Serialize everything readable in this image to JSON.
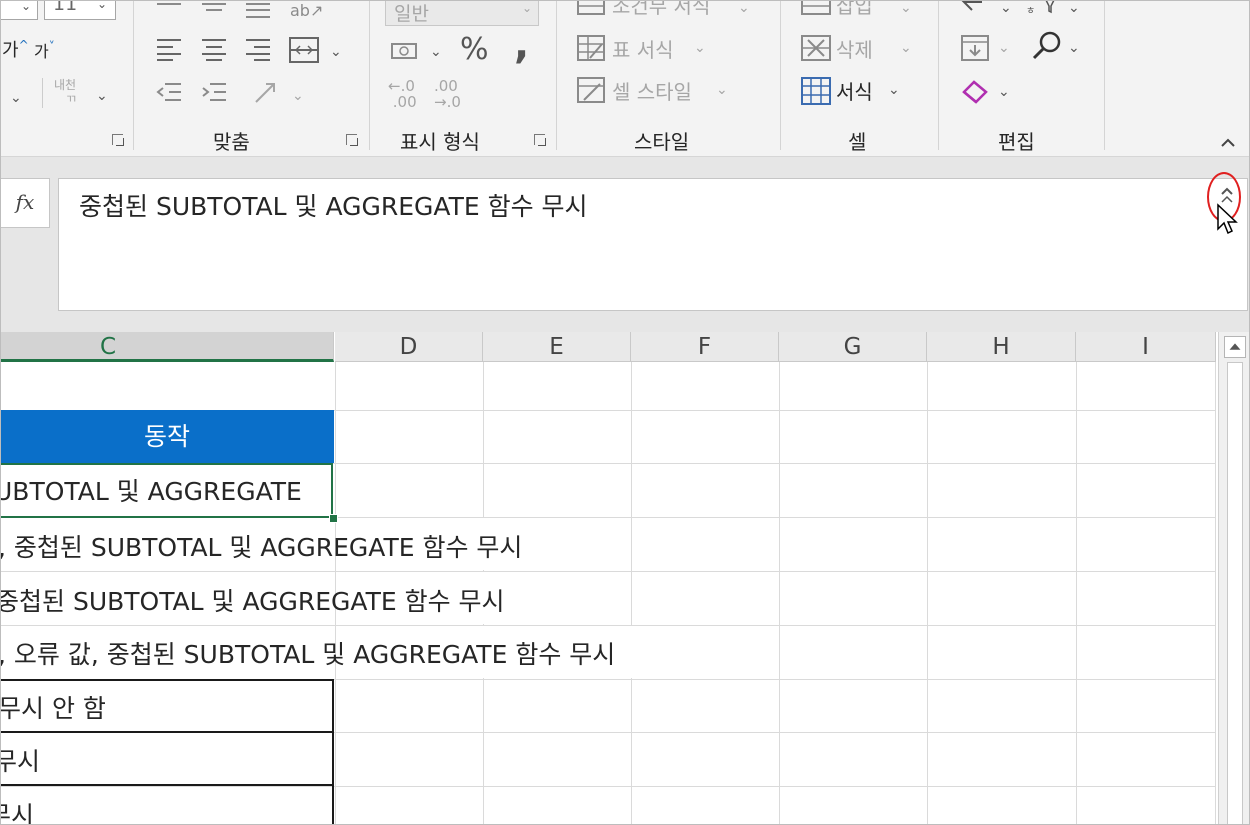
{
  "ribbon": {
    "font_size_value": "11",
    "number_format_value": "일반",
    "groups": {
      "alignment": "맞춤",
      "number": "표시 형식",
      "styles": "스타일",
      "cells": "셀",
      "editing": "편집"
    },
    "styles_items": {
      "conditional": "조건부 서식",
      "format_table": "표 서식",
      "cell_styles": "셀 스타일"
    },
    "cells_items": {
      "insert": "삽입",
      "delete": "삭제",
      "format": "서식"
    },
    "font_items": {
      "grow_font": "가",
      "shrink_font": "가",
      "phonetic": "내천"
    },
    "number_items": {
      "percent": "%",
      "comma": ",",
      "inc_decimal_top": ".0",
      "inc_decimal_bottom": ".00",
      "dec_decimal_top": ".00",
      "dec_decimal_bottom": "→.0"
    }
  },
  "formula_bar": {
    "fx_label": "fx",
    "value": "중첩된 SUBTOTAL 및 AGGREGATE 함수 무시"
  },
  "columns": [
    "C",
    "D",
    "E",
    "F",
    "G",
    "H",
    "I"
  ],
  "cells": {
    "header": "동작",
    "row1": "UBTOTAL 및 AGGREGATE",
    "row2": ", 중첩된 SUBTOTAL 및 AGGREGATE 함수 무시",
    "row3": "중첩된 SUBTOTAL 및 AGGREGATE 함수 무시",
    "row4": ", 오류 값, 중첩된 SUBTOTAL 및 AGGREGATE 함수 무시",
    "row5": " 무시 안 함",
    "row6": " 무시",
    "row7": "무시"
  },
  "colors": {
    "header_fill": "#0a6fc9",
    "selection_green": "#217346",
    "highlight_ring": "#e02020"
  }
}
